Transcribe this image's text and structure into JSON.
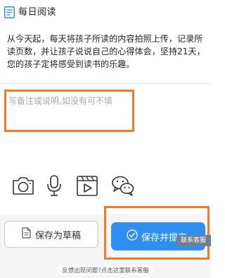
{
  "header": {
    "icon": "book-note-icon",
    "title": "每日阅读"
  },
  "intro": {
    "text": "从今天起，每天将孩子所读的内容拍照上传，记录所读页数，并让孩子说说自己的心得体会，坚持21天，您的孩子定将感受到读书的乐趣。"
  },
  "note": {
    "placeholder": "写备注或说明,如没有可不填",
    "value": ""
  },
  "media": {
    "icons": [
      "camera-icon",
      "microphone-icon",
      "video-icon",
      "wechat-icon"
    ]
  },
  "actions": {
    "draft_label": "保存为草稿",
    "save_label": "保存并提交",
    "customer_service_label": "联系客服"
  },
  "footer": {
    "feedback_text": "反馈出现问题?点击这里联系客服"
  },
  "colors": {
    "accent_blue": "#2f8ff0",
    "highlight_orange": "#f07b2a",
    "service_tag": "#6d7f95"
  }
}
